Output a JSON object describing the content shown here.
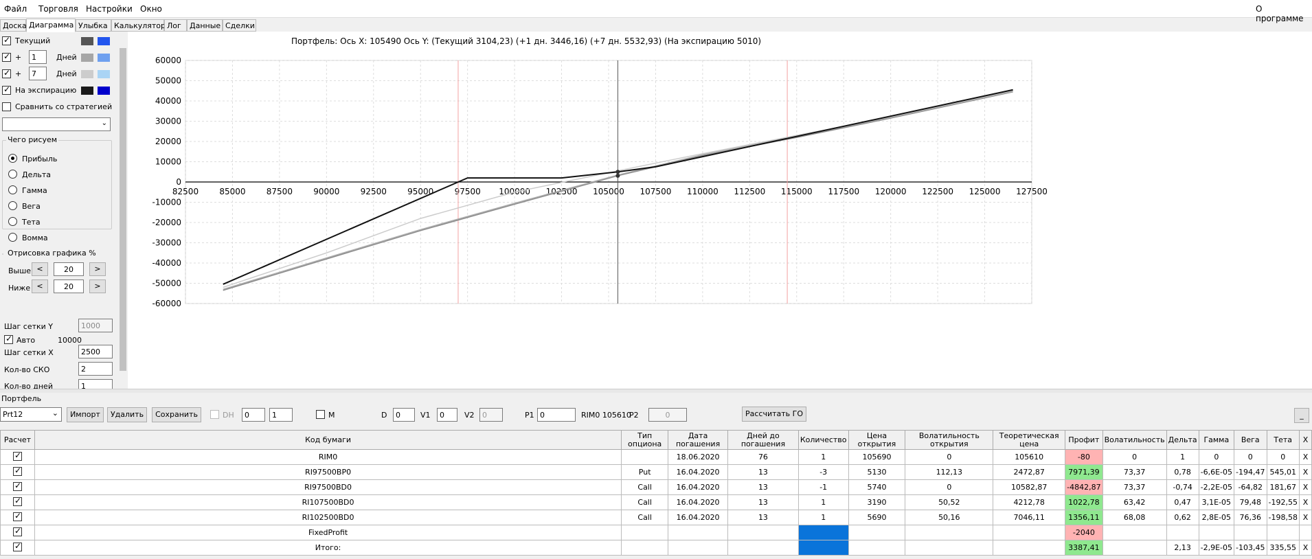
{
  "menu": {
    "file": "Файл",
    "trade": "Торговля",
    "settings": "Настройки",
    "window": "Окно",
    "about": "О программе"
  },
  "tabs": [
    "Доска",
    "Диаграмма",
    "Улыбка",
    "Калькулятор",
    "Лог",
    "Данные",
    "Сделки"
  ],
  "left": {
    "current": "Текущий",
    "plus1": "+",
    "days1": "1",
    "days_lbl1": "Дней",
    "plus2": "+",
    "days2": "7",
    "days_lbl2": "Дней",
    "expiry": "На экспирацию",
    "compare": "Сравнить со стратегией",
    "what_title": "Чего рисуем",
    "radios": [
      "Прибыль",
      "Дельта",
      "Гамма",
      "Вега",
      "Тета",
      "Вомма"
    ],
    "render_title": "Отрисовка графика %",
    "above": "Выше",
    "above_val": "20",
    "below": "Ниже",
    "below_val": "20",
    "lt": "<",
    "gt": ">",
    "grid_y": "Шаг сетки Y",
    "grid_y_val": "1000",
    "auto": "Авто",
    "auto_val": "10000",
    "grid_x": "Шаг сетки X",
    "grid_x_val": "2500",
    "sko": "Кол-во СКО",
    "sko_val": "2",
    "days_cnt": "Кол-во дней",
    "days_cnt_val": "1",
    "colors": {
      "current": [
        "#555555",
        "#2255ee"
      ],
      "p1": [
        "#a6a6a6",
        "#6fa0ef"
      ],
      "p7": [
        "#cccccc",
        "#aad4f5"
      ],
      "exp": [
        "#1a1a1a",
        "#0000cc"
      ]
    }
  },
  "chart_data": {
    "type": "line",
    "title": "Портфель: Ось X: 105490 Ось Y:  (Текущий 3104,23)  (+1 дн. 3446,16)  (+7 дн. 5532,93)  (На экспирацию 5010)",
    "xlim": [
      82500,
      127500
    ],
    "ylim": [
      -60000,
      60000
    ],
    "x_ticks": [
      82500,
      85000,
      87500,
      90000,
      92500,
      95000,
      97500,
      100000,
      102500,
      105000,
      107500,
      110000,
      112500,
      115000,
      117500,
      120000,
      122500,
      125000,
      127500
    ],
    "y_ticks": [
      60000,
      50000,
      40000,
      30000,
      20000,
      10000,
      0,
      -10000,
      -20000,
      -30000,
      -40000,
      -50000,
      -60000
    ],
    "vlines_red": [
      97000,
      114500
    ],
    "vline_cursor": 105490,
    "series": [
      {
        "color": "#111111",
        "x": [
          84500,
          97500,
          102500,
          105490,
          107500,
          126500
        ],
        "y": [
          -50500,
          2000,
          2000,
          5010,
          7500,
          45500
        ]
      },
      {
        "color": "#cccccc",
        "x": [
          84500,
          90000,
          95000,
          100000,
          105490,
          110000,
          115000,
          120000,
          126500
        ],
        "y": [
          -52000,
          -35000,
          -18000,
          -5000,
          5532,
          14000,
          23000,
          32000,
          45000
        ]
      },
      {
        "color": "#888888",
        "x": [
          84500,
          90000,
          95000,
          100000,
          105490,
          110000,
          115000,
          120000,
          126500
        ],
        "y": [
          -53500,
          -38000,
          -24000,
          -11000,
          3104,
          13000,
          22000,
          31500,
          44500
        ]
      },
      {
        "color": "#aaaaaa",
        "x": [
          84500,
          90000,
          95000,
          100000,
          105490,
          110000,
          115000,
          120000,
          126500
        ],
        "y": [
          -53000,
          -37500,
          -23500,
          -10500,
          3446,
          13500,
          22500,
          31800,
          44700
        ]
      }
    ]
  },
  "portfolio": {
    "title": "Портфель",
    "select": "Prt12",
    "import": "Импорт",
    "delete": "Удалить",
    "save": "Сохранить",
    "dh": "DH",
    "dh1": "0",
    "dh2": "1",
    "m": "M",
    "d": "D",
    "d_val": "0",
    "v1": "V1",
    "v1_val": "0",
    "v2": "V2",
    "v2_val": "0",
    "p1": "P1",
    "p1_val": "0",
    "rim": "RIM0 105610",
    "p2": "P2",
    "p2_val": "0",
    "calc_go": "Рассчитать ГО",
    "minimize": "_"
  },
  "table": {
    "headers": [
      "Расчет",
      "Код бумаги",
      "Тип опциона",
      "Дата погашения",
      "Дней до погашения",
      "Количество",
      "Цена открытия",
      "Волатильность открытия",
      "Теоретическая цена",
      "Профит",
      "Волатильность",
      "Дельта",
      "Гамма",
      "Вега",
      "Тета",
      "X"
    ],
    "rows": [
      [
        "",
        "RIM0",
        "",
        "18.06.2020",
        "76",
        "1",
        "105690",
        "0",
        "105610",
        "-80",
        "0",
        "1",
        "0",
        "0",
        "0",
        "X"
      ],
      [
        "",
        "RI97500BP0",
        "Put",
        "16.04.2020",
        "13",
        "-3",
        "5130",
        "112,13",
        "2472,87",
        "7971,39",
        "73,37",
        "0,78",
        "-6,6E-05",
        "-194,47",
        "545,01",
        "X"
      ],
      [
        "",
        "RI97500BD0",
        "Call",
        "16.04.2020",
        "13",
        "-1",
        "5740",
        "0",
        "10582,87",
        "-4842,87",
        "73,37",
        "-0,74",
        "-2,2E-05",
        "-64,82",
        "181,67",
        "X"
      ],
      [
        "",
        "RI107500BD0",
        "Call",
        "16.04.2020",
        "13",
        "1",
        "3190",
        "50,52",
        "4212,78",
        "1022,78",
        "63,42",
        "0,47",
        "3,1E-05",
        "79,48",
        "-192,55",
        "X"
      ],
      [
        "",
        "RI102500BD0",
        "Call",
        "16.04.2020",
        "13",
        "1",
        "5690",
        "50,16",
        "7046,11",
        "1356,11",
        "68,08",
        "0,62",
        "2,8E-05",
        "76,36",
        "-198,58",
        "X"
      ],
      [
        "",
        "FixedProfit",
        "",
        "",
        "",
        "",
        "",
        "",
        "",
        "-2040",
        "",
        "",
        "",
        "",
        "",
        ""
      ],
      [
        "",
        "Итого:",
        "",
        "",
        "",
        "",
        "",
        "",
        "",
        "3387,41",
        "",
        "2,13",
        "-2,9E-05",
        "-103,45",
        "335,55",
        "X"
      ]
    ]
  }
}
